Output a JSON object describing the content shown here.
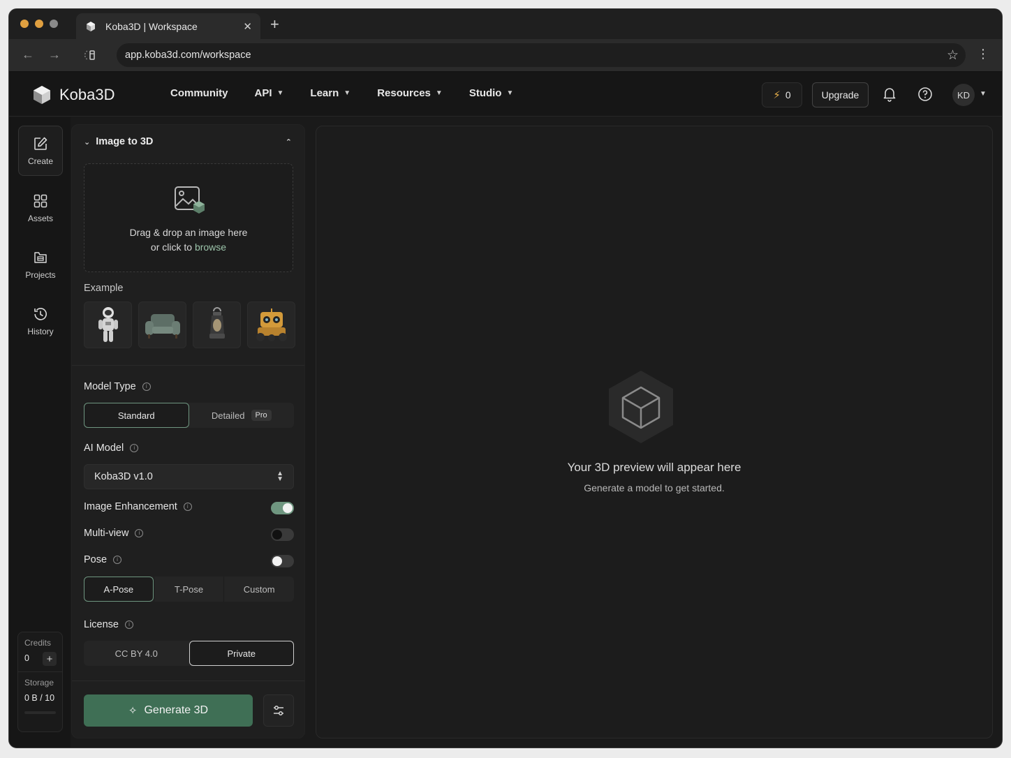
{
  "browser": {
    "tab_title": "Koba3D  |  Workspace",
    "url": "app.koba3d.com/workspace"
  },
  "header": {
    "logo": "Koba3D",
    "nav": [
      {
        "label": "Community",
        "has_menu": false
      },
      {
        "label": "API",
        "has_menu": true
      },
      {
        "label": "Learn",
        "has_menu": true
      },
      {
        "label": "Resources",
        "has_menu": true
      },
      {
        "label": "Studio",
        "has_menu": true
      }
    ],
    "credits": "0",
    "upgrade_label": "Upgrade",
    "avatar_initials": "KD"
  },
  "rail": {
    "items": [
      {
        "label": "Create",
        "icon": "edit-icon"
      },
      {
        "label": "Assets",
        "icon": "grid-icon"
      },
      {
        "label": "Projects",
        "icon": "folder-icon"
      },
      {
        "label": "History",
        "icon": "clock-icon"
      }
    ],
    "credits_label": "Credits",
    "credits_value": "0",
    "storage_label": "Storage",
    "storage_value": "0 B / 10",
    "storage_used_fraction": 0
  },
  "panel": {
    "section_title": "Image to 3D",
    "dropzone_line1": "Drag & drop an image here",
    "dropzone_line2_prefix": "or click to ",
    "dropzone_link": "browse",
    "example_label": "Example",
    "examples": [
      "astronaut",
      "armchair",
      "lantern",
      "robot"
    ],
    "model_type_label": "Model Type",
    "model_types": [
      "Standard",
      "Detailed"
    ],
    "model_type_selected": "Standard",
    "pro_badge": "Pro",
    "ai_model_label": "AI Model",
    "ai_model_value": "Koba3D v1.0",
    "image_enhancement_label": "Image Enhancement",
    "image_enhancement_on": true,
    "multiview_label": "Multi-view",
    "multiview_on": false,
    "pose_label": "Pose",
    "pose_on": false,
    "poses": [
      "A-Pose",
      "T-Pose",
      "Custom"
    ],
    "pose_selected": "A-Pose",
    "license_label": "License",
    "licenses": [
      "CC BY 4.0",
      "Private"
    ],
    "license_selected": "Private",
    "generate_label": "Generate 3D"
  },
  "preview": {
    "title": "Your 3D preview will appear here",
    "subtitle": "Generate a model to get started."
  },
  "colors": {
    "accent": "#3f6f55",
    "accent_light": "#6f9680",
    "bolt": "#e8b04a",
    "background": "#161616"
  }
}
